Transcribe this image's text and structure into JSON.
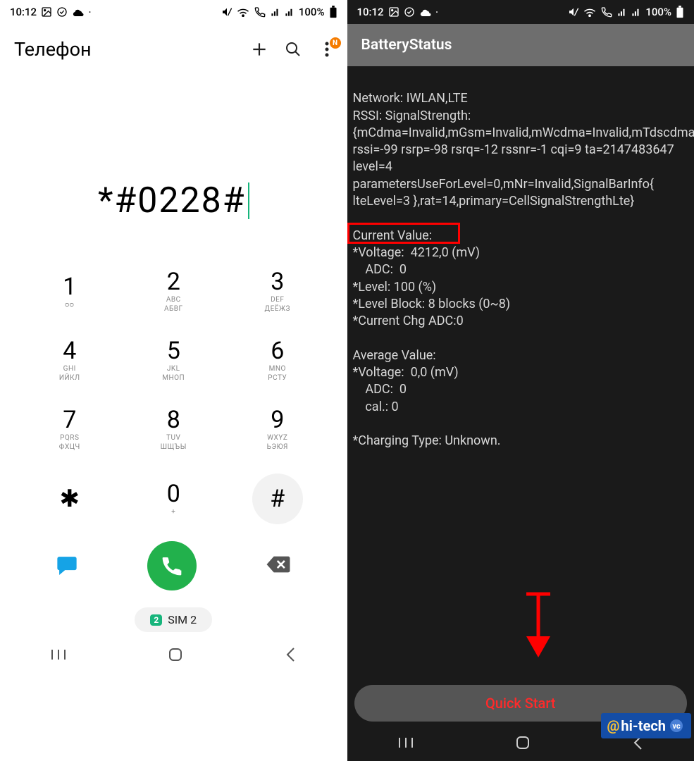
{
  "status": {
    "time": "10:12",
    "battery": "100%"
  },
  "phone": {
    "title": "Телефон",
    "dialed": "*#0228#",
    "badge": "N",
    "keys": [
      {
        "n": "1",
        "s1": "",
        "s2": "ᴑᴑ"
      },
      {
        "n": "2",
        "s1": "ABC",
        "s2": "АБВГ"
      },
      {
        "n": "3",
        "s1": "DEF",
        "s2": "ДЕЁЖЗ"
      },
      {
        "n": "4",
        "s1": "GHI",
        "s2": "ИЙКЛ"
      },
      {
        "n": "5",
        "s1": "JKL",
        "s2": "МНОП"
      },
      {
        "n": "6",
        "s1": "MNO",
        "s2": "РСТУ"
      },
      {
        "n": "7",
        "s1": "PQRS",
        "s2": "ФХЦЧ"
      },
      {
        "n": "8",
        "s1": "TUV",
        "s2": "ШЩЪЫ"
      },
      {
        "n": "9",
        "s1": "WXYZ",
        "s2": "ЬЭЮЯ"
      },
      {
        "n": "*",
        "s1": "",
        "s2": ""
      },
      {
        "n": "0",
        "s1": "",
        "s2": "+"
      },
      {
        "n": "#",
        "s1": "",
        "s2": ""
      }
    ],
    "sim_label": "SIM 2",
    "sim_slot": "2"
  },
  "battery_status": {
    "title": "BatteryStatus",
    "network_line": "Network: IWLAN,LTE",
    "rssi_block": "RSSI: SignalStrength:{mCdma=Invalid,mGsm=Invalid,mWcdma=Invalid,mTdscdma=Invalid,mLte=CellSignalStrengthLte: rssi=-99 rsrp=-98 rsrq=-12 rssnr=-1 cqi=9 ta=2147483647 level=4 parametersUseForLevel=0,mNr=Invalid,SignalBarInfo{ lteLevel=3 },rat=14,primary=CellSignalStrengthLte}",
    "current_header": "Current Value:",
    "voltage": "*Voltage:  4212,0 (mV)",
    "adc": "    ADC:  0",
    "level": "*Level: 100 (%)",
    "level_block": "*Level Block: 8 blocks (0~8)",
    "current_chg": "*Current Chg ADC:0",
    "avg_header": "Average Value:",
    "avg_voltage": "*Voltage:  0,0 (mV)",
    "avg_adc": "    ADC:  0",
    "avg_cal": "    cal.: 0",
    "charging": "*Charging Type: Unknown.",
    "quick_start": "Quick Start"
  },
  "watermark": {
    "at": "@",
    "text": "hi-tech",
    "badge": "vc"
  }
}
